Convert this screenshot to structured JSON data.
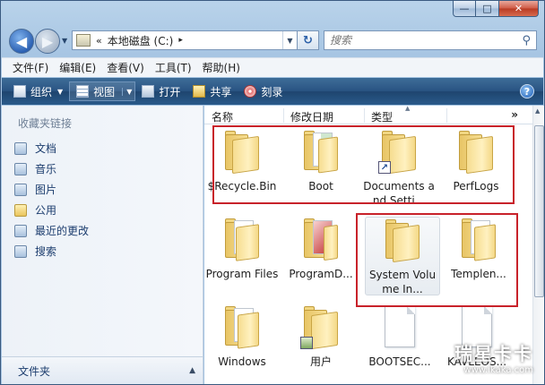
{
  "window": {
    "caption_buttons": {
      "minimize": "—",
      "maximize": "□",
      "close": "✕"
    }
  },
  "nav": {
    "back_icon": "back-arrow-icon",
    "forward_icon": "forward-arrow-icon"
  },
  "address": {
    "chevron": "«",
    "location": "本地磁盘 (C:)",
    "arrow": "▸"
  },
  "search": {
    "placeholder": "搜索"
  },
  "menu": [
    "文件(F)",
    "编辑(E)",
    "查看(V)",
    "工具(T)",
    "帮助(H)"
  ],
  "toolbar": {
    "organize": "组织",
    "views": "视图",
    "open": "打开",
    "share": "共享",
    "burn": "刻录",
    "help": "?"
  },
  "sidebar": {
    "header": "收藏夹链接",
    "items": [
      "文档",
      "音乐",
      "图片",
      "公用",
      "最近的更改",
      "搜索"
    ],
    "folders_label": "文件夹",
    "folders_chevron": "▲"
  },
  "columns": [
    "名称",
    "修改日期",
    "类型"
  ],
  "columns_more": "»",
  "files": [
    {
      "name": "$Recycle.Bin"
    },
    {
      "name": "Boot"
    },
    {
      "name": "Documents and Setti..."
    },
    {
      "name": "PerfLogs"
    },
    {
      "name": "Program Files"
    },
    {
      "name": "ProgramD..."
    },
    {
      "name": "System Volume In..."
    },
    {
      "name": "Templen..."
    },
    {
      "name": "Windows"
    },
    {
      "name": "用户"
    },
    {
      "name": "BOOTSEC..."
    },
    {
      "name": "KAVLEOS..."
    }
  ],
  "watermark": {
    "line1": "瑞星卡卡",
    "line2": "www.ikaka.com"
  },
  "colors": {
    "highlight_box": "#c8222a",
    "toolbar_blue": "#2a5483"
  }
}
